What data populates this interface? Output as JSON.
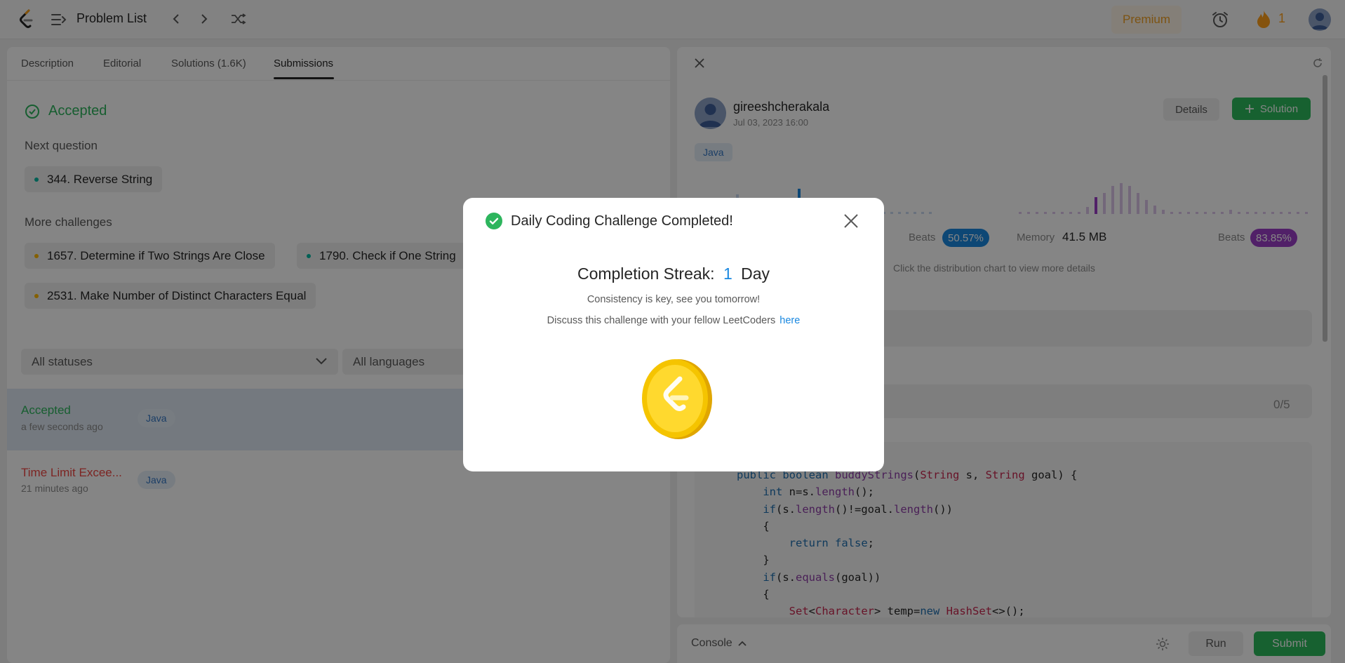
{
  "topbar": {
    "title": "Problem List",
    "premium_label": "Premium",
    "streak_count": "1"
  },
  "left": {
    "tabs": [
      {
        "label": "Description"
      },
      {
        "label": "Editorial"
      },
      {
        "label": "Solutions (1.6K)"
      },
      {
        "label": "Submissions",
        "active": true
      }
    ],
    "result_label": "Accepted",
    "next_label": "Next question",
    "next_question": "344. Reverse String",
    "more_label": "More challenges",
    "challenges": [
      "1657. Determine if Two Strings Are Close",
      "1790. Check if One String",
      "2531. Make Number of Distinct Characters Equal"
    ],
    "filters": {
      "status": "All statuses",
      "language": "All languages"
    },
    "submissions": [
      {
        "status": "Accepted",
        "time": "a few seconds ago",
        "lang": "Java"
      },
      {
        "status": "Time Limit Excee...",
        "time": "21 minutes ago",
        "lang": "Java"
      }
    ]
  },
  "right": {
    "username": "gireeshcherakala",
    "date": "Jul 03, 2023 16:00",
    "details_label": "Details",
    "solution_label": "Solution",
    "lang": "Java",
    "beats_label": "Beats",
    "runtime_beats": "50.57%",
    "memory_label": "Memory",
    "memory_value": "41.5 MB",
    "memory_beats": "83.85%",
    "hint": "Click the distribution chart to view more details",
    "testcase_count": "0/5"
  },
  "console": {
    "label": "Console",
    "run_label": "Run",
    "submit_label": "Submit"
  },
  "modal": {
    "title": "Daily Coding Challenge Completed!",
    "streak_prefix": "Completion Streak:",
    "streak_value": "1",
    "streak_unit": "Day",
    "line1": "Consistency is key, see you tomorrow!",
    "line2": "Discuss this challenge with your fellow LeetCoders",
    "link": "here"
  },
  "colors": {
    "accepted": "#2db55d",
    "tle": "#ef4743",
    "accent_blue": "#1a88e0",
    "runtime_badge": "#1a88e0",
    "memory_badge": "#9c3fc7",
    "submit_green": "#2cbb5d"
  }
}
